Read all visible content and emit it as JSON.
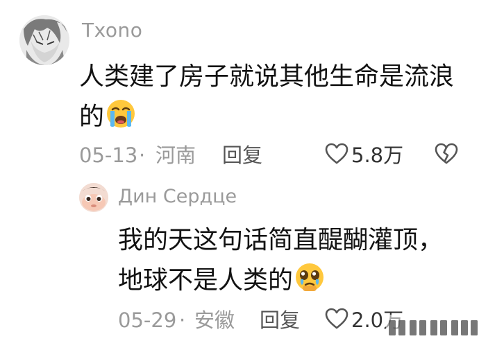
{
  "comment": {
    "username": "Txono",
    "text": "人类建了房子就说其他生命是流浪的",
    "emoji": "crying-face",
    "date": "05-13",
    "separator": "·",
    "location": "河南",
    "reply_label": "回复",
    "likes": "5.8万"
  },
  "reply": {
    "username": "Дин Сердце",
    "text": "我的天这句话简直醍醐灌顶，地球不是人类的",
    "emoji": "pleading-face",
    "date": "05-29",
    "separator": "·",
    "location": "安徽",
    "reply_label": "回复",
    "likes": "2.0万"
  },
  "colors": {
    "text": "#121212",
    "meta": "#9a9a9a",
    "icon": "#555555",
    "emoji_yellow": "#ffc83d",
    "tear_blue": "#5bb8f0"
  }
}
